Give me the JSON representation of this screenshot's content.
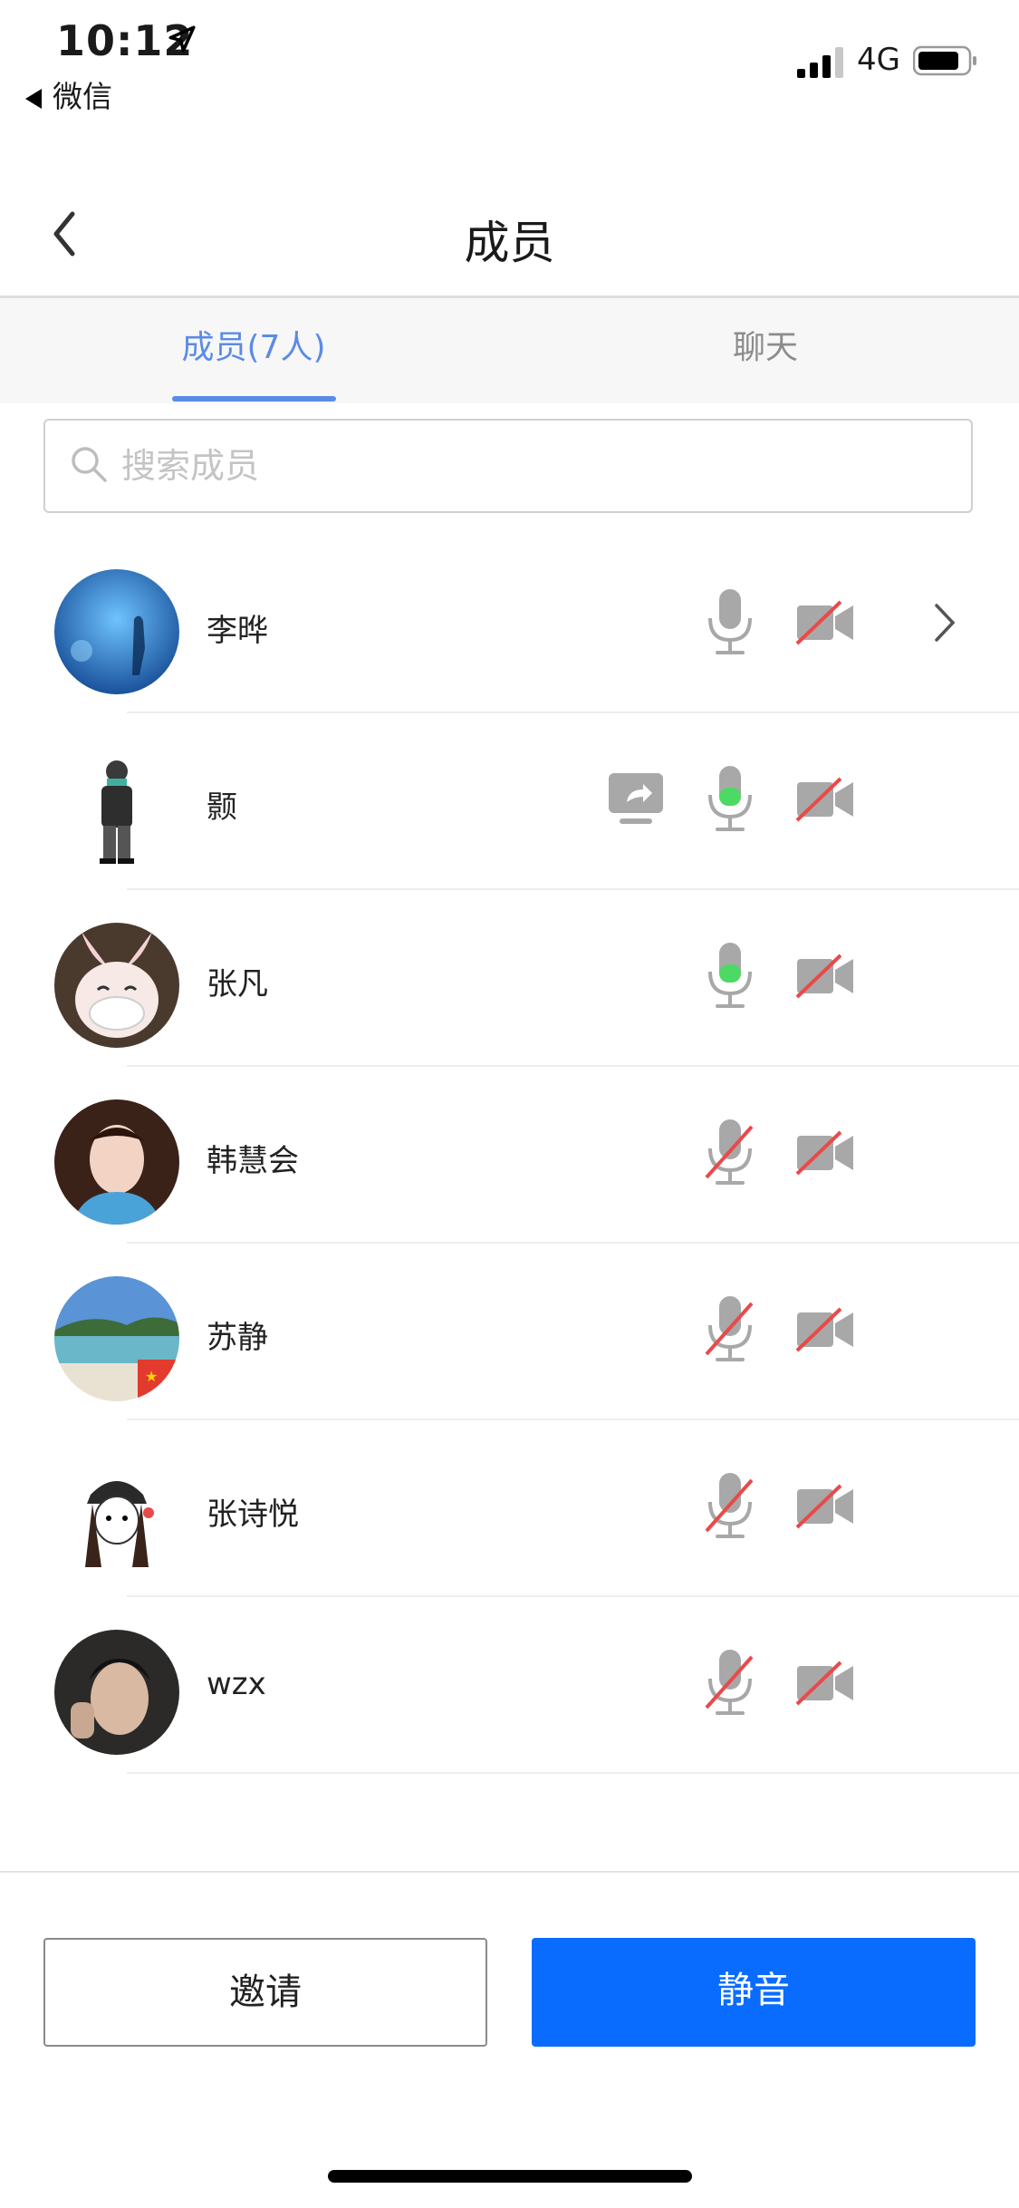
{
  "status_bar": {
    "time": "10:12",
    "back_app": "微信",
    "carrier": "4G"
  },
  "nav": {
    "title": "成员"
  },
  "tabs": [
    {
      "label": "成员(7人)",
      "active": true
    },
    {
      "label": "聊天",
      "active": false
    }
  ],
  "search": {
    "placeholder": "搜索成员",
    "value": ""
  },
  "members": [
    {
      "name": "李晔",
      "mic": "muted-off",
      "mic_state": "on-idle",
      "camera": "off",
      "screen_share": false,
      "chevron": true
    },
    {
      "name": "颢",
      "mic_state": "speaking",
      "camera": "off",
      "screen_share": true,
      "chevron": false
    },
    {
      "name": "张凡",
      "mic_state": "speaking",
      "camera": "off",
      "screen_share": false,
      "chevron": false
    },
    {
      "name": "韩慧会",
      "mic_state": "muted",
      "camera": "off",
      "screen_share": false,
      "chevron": false
    },
    {
      "name": "苏静",
      "mic_state": "muted",
      "camera": "off",
      "screen_share": false,
      "chevron": false
    },
    {
      "name": "张诗悦",
      "mic_state": "muted",
      "camera": "off",
      "screen_share": false,
      "chevron": false
    },
    {
      "name": "wzx",
      "mic_state": "muted",
      "camera": "off",
      "screen_share": false,
      "chevron": false
    }
  ],
  "buttons": {
    "invite": "邀请",
    "mute": "静音"
  },
  "colors": {
    "accent_blue": "#0a6cff",
    "tab_active": "#5b8be6",
    "speaking_green": "#4cd964",
    "muted_red": "#e84a4a",
    "icon_gray": "#a6a6a6"
  }
}
